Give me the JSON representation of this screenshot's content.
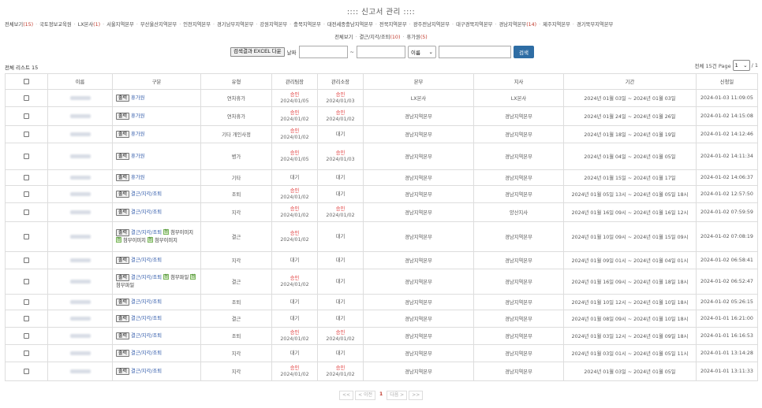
{
  "page_title": "::::  신고서 관리  ::::",
  "tabs_row1": [
    {
      "label": "전체보기",
      "count": "(15)"
    },
    {
      "label": "국토정보교육원",
      "count": ""
    },
    {
      "label": "LX본사",
      "count": "(1)"
    },
    {
      "label": "서울지역본부",
      "count": ""
    },
    {
      "label": "부산울산지역본부",
      "count": ""
    },
    {
      "label": "인천지역본부",
      "count": ""
    },
    {
      "label": "경기남부지역본부",
      "count": ""
    },
    {
      "label": "강원지역본부",
      "count": ""
    },
    {
      "label": "충북지역본부",
      "count": ""
    },
    {
      "label": "대전세종충남지역본부",
      "count": ""
    },
    {
      "label": "전북지역본부",
      "count": ""
    },
    {
      "label": "광주전남지역본부",
      "count": ""
    },
    {
      "label": "대구경북지역본부",
      "count": ""
    },
    {
      "label": "경남지역본부",
      "count": "(14)"
    },
    {
      "label": "제주지역본부",
      "count": ""
    },
    {
      "label": "경기북부지역본부",
      "count": ""
    }
  ],
  "tabs_row2": [
    {
      "label": "전체보기",
      "count": ""
    },
    {
      "label": "결근/지각/조퇴",
      "count": "(10)"
    },
    {
      "label": "휴가원",
      "count": "(5)"
    }
  ],
  "search": {
    "excel_label": "검색결과 EXCEL 다운",
    "date_label": "날짜",
    "range_sep": "~",
    "select_value": "이름",
    "button_label": "검색"
  },
  "list_total": "전체 리스트 15",
  "page_info": {
    "prefix": "전체 15건 Page",
    "current": "1",
    "suffix": "/ 1"
  },
  "table": {
    "headers": [
      "",
      "이름",
      "구분",
      "유형",
      "관리팀장",
      "관리소장",
      "본부",
      "지사",
      "기간",
      "신청일"
    ],
    "rows": [
      {
        "type": "휴가원",
        "attach": [],
        "kind": "연차휴가",
        "lead": {
          "status": "승인",
          "date": "2024/01/05"
        },
        "chief": {
          "status": "승인",
          "date": "2024/01/03"
        },
        "hq": "LX본사",
        "branch": "LX본사",
        "period": "2024년 01월 03일 ~ 2024년 01월 03일",
        "applied": "2024-01-03 11:09:05"
      },
      {
        "type": "휴가원",
        "attach": [],
        "kind": "연차휴가",
        "lead": {
          "status": "승인",
          "date": "2024/01/02"
        },
        "chief": {
          "status": "승인",
          "date": "2024/01/02"
        },
        "hq": "경남지역본부",
        "branch": "경남지역본부",
        "period": "2024년 01월 24일 ~ 2024년 01월 26일",
        "applied": "2024-01-02 14:15:08"
      },
      {
        "type": "휴가원",
        "attach": [],
        "kind": "기타 개인사정",
        "lead": {
          "status": "승인",
          "date": "2024/01/02"
        },
        "chief": {
          "status": "대기",
          "date": ""
        },
        "hq": "경남지역본부",
        "branch": "경남지역본부",
        "period": "2024년 01월 18일 ~ 2024년 01월 19일",
        "applied": "2024-01-02 14:12:46"
      },
      {
        "type": "휴가원",
        "attach": [],
        "kind": "병가",
        "lead": {
          "status": "승인",
          "date": "2024/01/05"
        },
        "chief": {
          "status": "승인",
          "date": "2024/01/03"
        },
        "hq": "경남지역본부",
        "branch": "경남지역본부",
        "period": "2024년 01월 04일 ~ 2024년 01월 05일",
        "applied": "2024-01-02 14:11:34"
      },
      {
        "type": "휴가원",
        "attach": [],
        "kind": "기타",
        "lead": {
          "status": "대기",
          "date": ""
        },
        "chief": {
          "status": "대기",
          "date": ""
        },
        "hq": "경남지역본부",
        "branch": "경남지역본부",
        "period": "2024년 01월 15일 ~ 2024년 01월 17일",
        "applied": "2024-01-02 14:06:37"
      },
      {
        "type": "결근/지각/조퇴",
        "attach": [],
        "kind": "조퇴",
        "lead": {
          "status": "승인",
          "date": "2024/01/02"
        },
        "chief": {
          "status": "대기",
          "date": ""
        },
        "hq": "경남지역본부",
        "branch": "경남지역본부",
        "period": "2024년 01월 05일 13시 ~ 2024년 01월 05일 18시",
        "applied": "2024-01-02 12:57:50"
      },
      {
        "type": "결근/지각/조퇴",
        "attach": [],
        "kind": "지각",
        "lead": {
          "status": "승인",
          "date": "2024/01/02"
        },
        "chief": {
          "status": "승인",
          "date": "2024/01/02"
        },
        "hq": "경남지역본부",
        "branch": "양산지사",
        "period": "2024년 01월 16일 09시 ~ 2024년 01월 16일 12시",
        "applied": "2024-01-02 07:59:59"
      },
      {
        "type": "결근/지각/조퇴",
        "attach": [
          "첨부이미지",
          "첨부이미지",
          "첨부이미지"
        ],
        "kind": "결근",
        "lead": {
          "status": "승인",
          "date": "2024/01/02"
        },
        "chief": {
          "status": "대기",
          "date": ""
        },
        "hq": "경남지역본부",
        "branch": "경남지역본부",
        "period": "2024년 01월 10일 09시 ~ 2024년 01월 15일 09시",
        "applied": "2024-01-02 07:08:19"
      },
      {
        "type": "결근/지각/조퇴",
        "attach": [],
        "kind": "지각",
        "lead": {
          "status": "대기",
          "date": ""
        },
        "chief": {
          "status": "대기",
          "date": ""
        },
        "hq": "경남지역본부",
        "branch": "경남지역본부",
        "period": "2024년 01월 09일 01시 ~ 2024년 01월 04일 01시",
        "applied": "2024-01-02 06:58:41"
      },
      {
        "type": "결근/지각/조퇴",
        "attach": [
          "첨부파일",
          "첨부파일"
        ],
        "kind": "결근",
        "lead": {
          "status": "승인",
          "date": "2024/01/02"
        },
        "chief": {
          "status": "대기",
          "date": ""
        },
        "hq": "경남지역본부",
        "branch": "경남지역본부",
        "period": "2024년 01월 16일 09시 ~ 2024년 01월 18일 18시",
        "applied": "2024-01-02 06:52:47"
      },
      {
        "type": "결근/지각/조퇴",
        "attach": [],
        "kind": "조퇴",
        "lead": {
          "status": "대기",
          "date": ""
        },
        "chief": {
          "status": "대기",
          "date": ""
        },
        "hq": "경남지역본부",
        "branch": "경남지역본부",
        "period": "2024년 01월 10일 12시 ~ 2024년 01월 10일 18시",
        "applied": "2024-01-02 05:26:15"
      },
      {
        "type": "결근/지각/조퇴",
        "attach": [],
        "kind": "결근",
        "lead": {
          "status": "대기",
          "date": ""
        },
        "chief": {
          "status": "대기",
          "date": ""
        },
        "hq": "경남지역본부",
        "branch": "경남지역본부",
        "period": "2024년 01월 08일 09시 ~ 2024년 01월 10일 18시",
        "applied": "2024-01-01 16:21:00"
      },
      {
        "type": "결근/지각/조퇴",
        "attach": [],
        "kind": "조퇴",
        "lead": {
          "status": "승인",
          "date": "2024/01/02"
        },
        "chief": {
          "status": "승인",
          "date": "2024/01/02"
        },
        "hq": "경남지역본부",
        "branch": "경남지역본부",
        "period": "2024년 01월 03일 12시 ~ 2024년 01월 09일 18시",
        "applied": "2024-01-01 16:16:53"
      },
      {
        "type": "결근/지각/조퇴",
        "attach": [],
        "kind": "지각",
        "lead": {
          "status": "대기",
          "date": ""
        },
        "chief": {
          "status": "대기",
          "date": ""
        },
        "hq": "경남지역본부",
        "branch": "경남지역본부",
        "period": "2024년 01월 03일 01시 ~ 2024년 01월 05일 11시",
        "applied": "2024-01-01 13:14:28"
      },
      {
        "type": "결근/지각/조퇴",
        "attach": [],
        "kind": "지각",
        "lead": {
          "status": "승인",
          "date": "2024/01/02"
        },
        "chief": {
          "status": "승인",
          "date": "2024/01/02"
        },
        "hq": "경남지역본부",
        "branch": "경남지역본부",
        "period": "2024년 01월 03일 ~ 2024년 01월 05일",
        "applied": "2024-01-01 13:11:33"
      }
    ],
    "print_label": "출력",
    "attach_icon": "첨"
  },
  "pager": {
    "first": "<<",
    "prev": "< 이전",
    "current": "1",
    "next": "다음 >",
    "last": ">>"
  },
  "colors": {
    "accent": "#2e6da4",
    "approved": "#e03434",
    "count": "#c0392b",
    "link": "#2b56a8"
  }
}
